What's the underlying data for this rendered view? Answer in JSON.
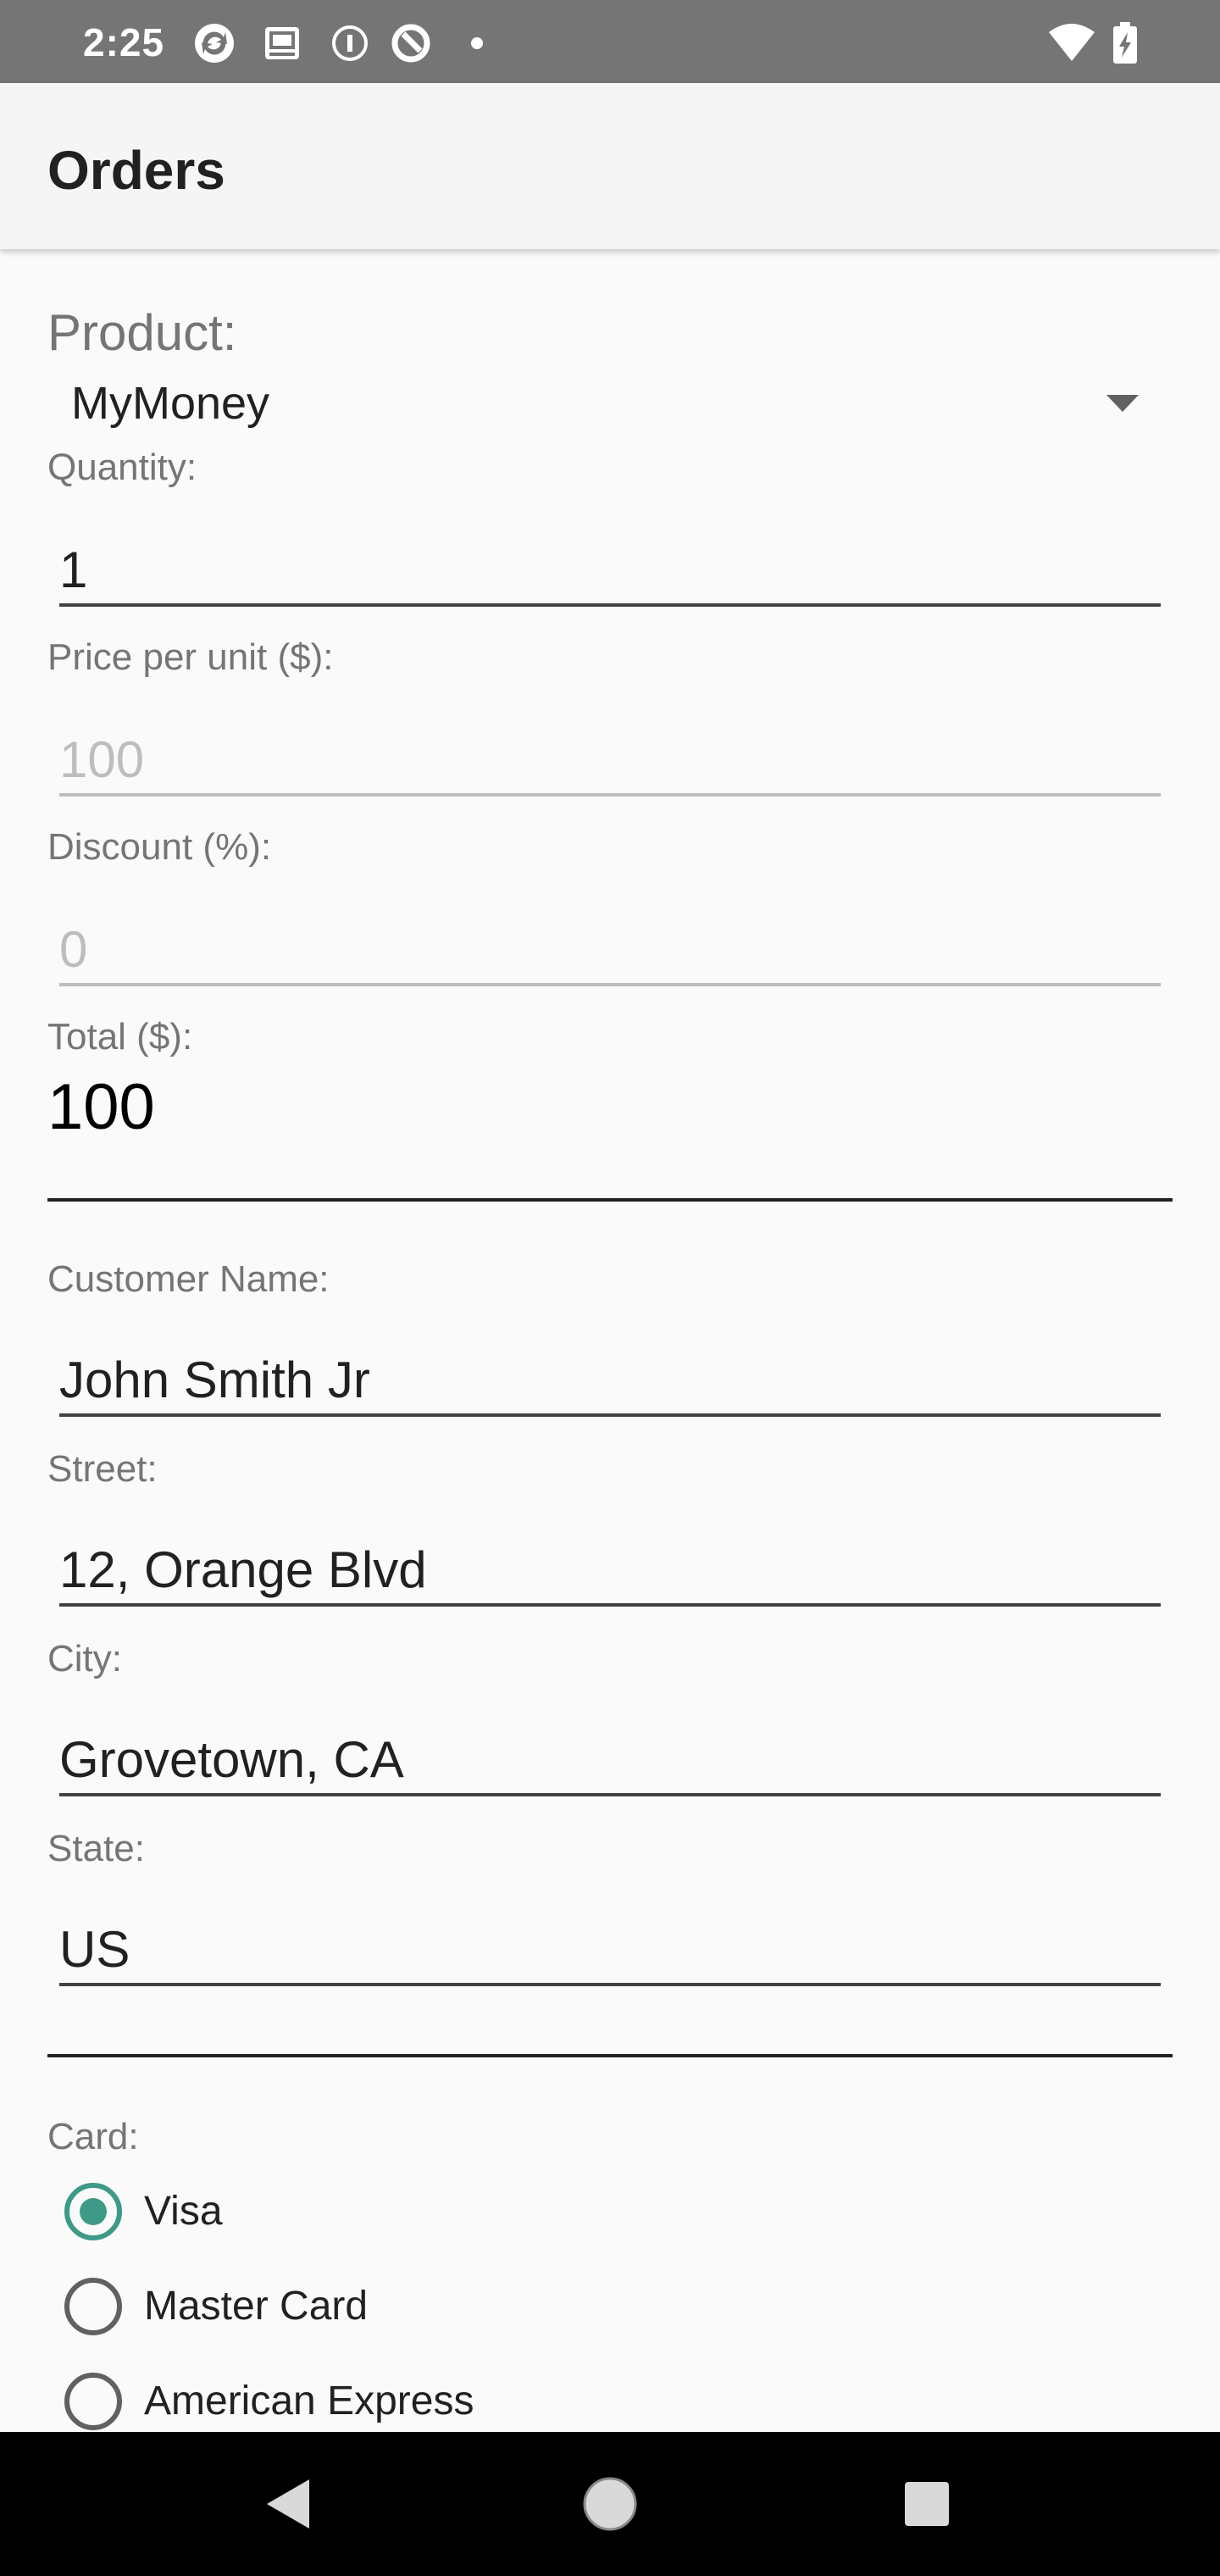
{
  "status_bar": {
    "time": "2:25",
    "left_icons": [
      "sync-icon",
      "photo-card-icon",
      "info-icon",
      "ring-icon",
      "dot-icon"
    ],
    "right_icons": [
      "wifi-icon",
      "battery-charging-icon"
    ]
  },
  "app_bar": {
    "title": "Orders"
  },
  "form": {
    "product_label": "Product:",
    "product_value": "MyMoney",
    "quantity_label": "Quantity:",
    "quantity_value": "1",
    "price_label": "Price per unit ($):",
    "price_value": "100",
    "discount_label": "Discount (%):",
    "discount_value": "0",
    "total_label": "Total ($):",
    "total_value": "100",
    "customer_label": "Customer Name:",
    "customer_value": "John Smith Jr",
    "street_label": "Street:",
    "street_value": "12, Orange Blvd",
    "city_label": "City:",
    "city_value": "Grovetown, CA",
    "state_label": "State:",
    "state_value": "US",
    "card_label": "Card:",
    "card_options": [
      {
        "label": "Visa",
        "checked": true
      },
      {
        "label": "Master Card",
        "checked": false
      },
      {
        "label": "American Express",
        "checked": false
      }
    ]
  },
  "nav_bar": {
    "buttons": [
      "back-icon",
      "home-icon",
      "recents-icon"
    ]
  },
  "colors": {
    "status_bar": "#757575",
    "app_bar": "#f5f5f5",
    "background": "#fafafa",
    "accent": "#3d9a86"
  }
}
